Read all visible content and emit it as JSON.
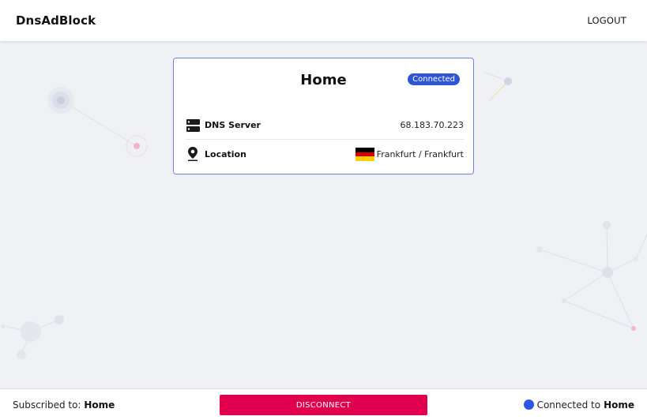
{
  "app": {
    "brand": "DnsAdBlock",
    "logout_label": "LOGOUT"
  },
  "card": {
    "title": "Home",
    "status_badge": "Connected",
    "rows": [
      {
        "icon": "server-icon",
        "label": "DNS Server",
        "value": "68.183.70.223"
      },
      {
        "icon": "location-pin-icon",
        "label": "Location",
        "value": "Frankfurt / Frankfurt",
        "flag": "germany-flag-icon"
      }
    ]
  },
  "footer": {
    "subscribed_prefix": "Subscribed to:",
    "subscribed_name": "Home",
    "disconnect_label": "DISCONNECT",
    "status_prefix": "Connected to",
    "status_name": "Home"
  },
  "colors": {
    "accent": "#2f55d4",
    "card_border": "#6d86e6",
    "disconnect": "#e0004d",
    "background": "#f0f1f5"
  }
}
